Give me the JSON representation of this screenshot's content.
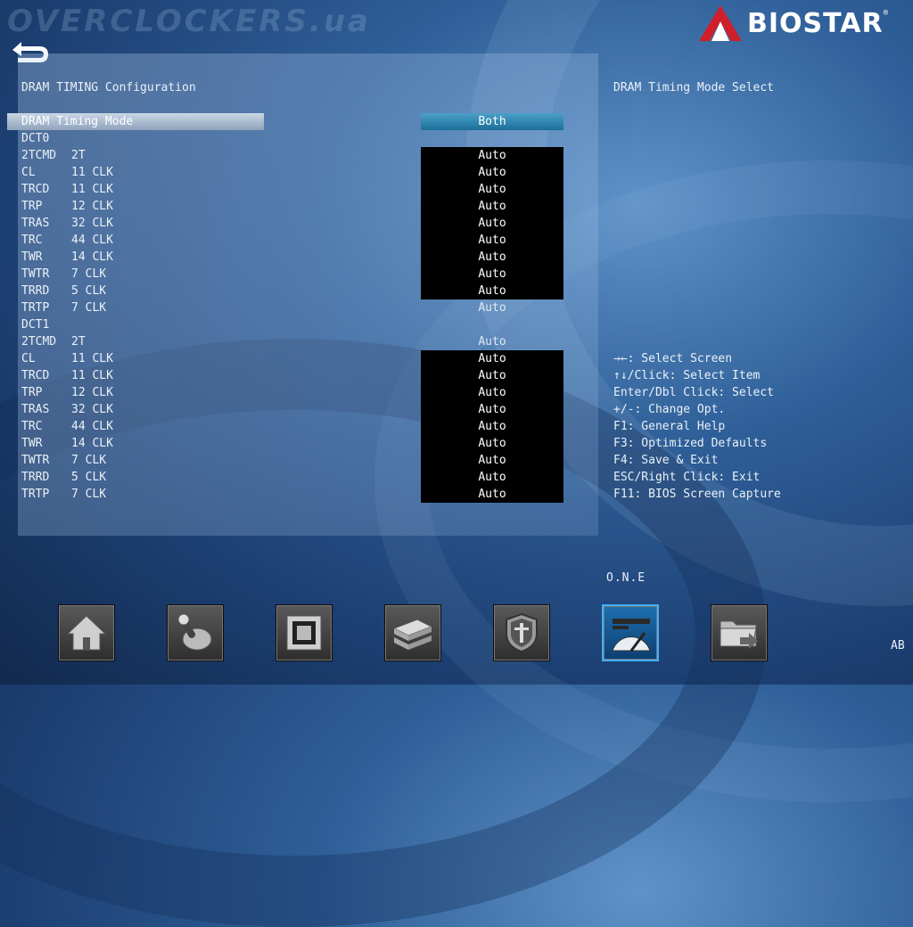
{
  "watermark": "OVERCLOCKERS.ua",
  "logo": {
    "text": "BIOSTAR",
    "reg": "®"
  },
  "section_title": "DRAM TIMING Configuration",
  "help_title": "DRAM Timing Mode Select",
  "selected_row": {
    "label": "DRAM Timing Mode",
    "value": "Both"
  },
  "dct0": {
    "header": "DCT0",
    "rows": [
      {
        "name": "2TCMD",
        "val": "2T",
        "setting": "Auto"
      },
      {
        "name": "CL",
        "val": "11 CLK",
        "setting": "Auto"
      },
      {
        "name": "TRCD",
        "val": "11 CLK",
        "setting": "Auto"
      },
      {
        "name": "TRP",
        "val": "12 CLK",
        "setting": "Auto"
      },
      {
        "name": "TRAS",
        "val": "32 CLK",
        "setting": "Auto"
      },
      {
        "name": "TRC",
        "val": "44 CLK",
        "setting": "Auto"
      },
      {
        "name": "TWR",
        "val": "14 CLK",
        "setting": "Auto"
      },
      {
        "name": "TWTR",
        "val": "7 CLK",
        "setting": "Auto"
      },
      {
        "name": "TRRD",
        "val": "5 CLK",
        "setting": "Auto"
      },
      {
        "name": "TRTP",
        "val": "7 CLK",
        "setting": "Auto"
      }
    ]
  },
  "dct1": {
    "header": "DCT1",
    "rows": [
      {
        "name": "2TCMD",
        "val": "2T",
        "setting": "Auto"
      },
      {
        "name": "CL",
        "val": "11 CLK",
        "setting": "Auto"
      },
      {
        "name": "TRCD",
        "val": "11 CLK",
        "setting": "Auto"
      },
      {
        "name": "TRP",
        "val": "12 CLK",
        "setting": "Auto"
      },
      {
        "name": "TRAS",
        "val": "32 CLK",
        "setting": "Auto"
      },
      {
        "name": "TRC",
        "val": "44 CLK",
        "setting": "Auto"
      },
      {
        "name": "TWR",
        "val": "14 CLK",
        "setting": "Auto"
      },
      {
        "name": "TWTR",
        "val": "7 CLK",
        "setting": "Auto"
      },
      {
        "name": "TRRD",
        "val": "5 CLK",
        "setting": "Auto"
      },
      {
        "name": "TRTP",
        "val": "7 CLK",
        "setting": "Auto"
      }
    ]
  },
  "key_help": [
    "→←: Select Screen",
    "↑↓/Click: Select Item",
    "Enter/Dbl Click: Select",
    "+/-: Change Opt.",
    "F1: General Help",
    "F3: Optimized Defaults",
    "F4: Save & Exit",
    "ESC/Right Click: Exit",
    "F11: BIOS Screen Capture"
  ],
  "one_label": "O.N.E",
  "ab_label": "AB",
  "nav_icons": [
    "home-icon",
    "joystick-icon",
    "chipset-icon",
    "storage-icon",
    "security-shield-icon",
    "speedometer-icon",
    "folder-exit-icon"
  ],
  "colors": {
    "accent": "#1b6f98",
    "active_border": "#3fb0ff",
    "brand_red": "#d01f2a"
  }
}
